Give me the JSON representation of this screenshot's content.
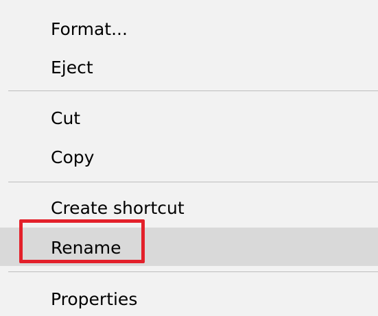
{
  "context_menu": {
    "items": [
      {
        "label": "Format..."
      },
      {
        "label": "Eject"
      },
      {
        "label": "Cut"
      },
      {
        "label": "Copy"
      },
      {
        "label": "Create shortcut"
      },
      {
        "label": "Rename",
        "state": "hovered"
      },
      {
        "label": "Properties"
      }
    ]
  },
  "colors": {
    "menu_background": "#f2f2f2",
    "hover_background": "#d9d9d9",
    "separator": "#bdbdbd",
    "annotation_outline": "#e3202a"
  }
}
